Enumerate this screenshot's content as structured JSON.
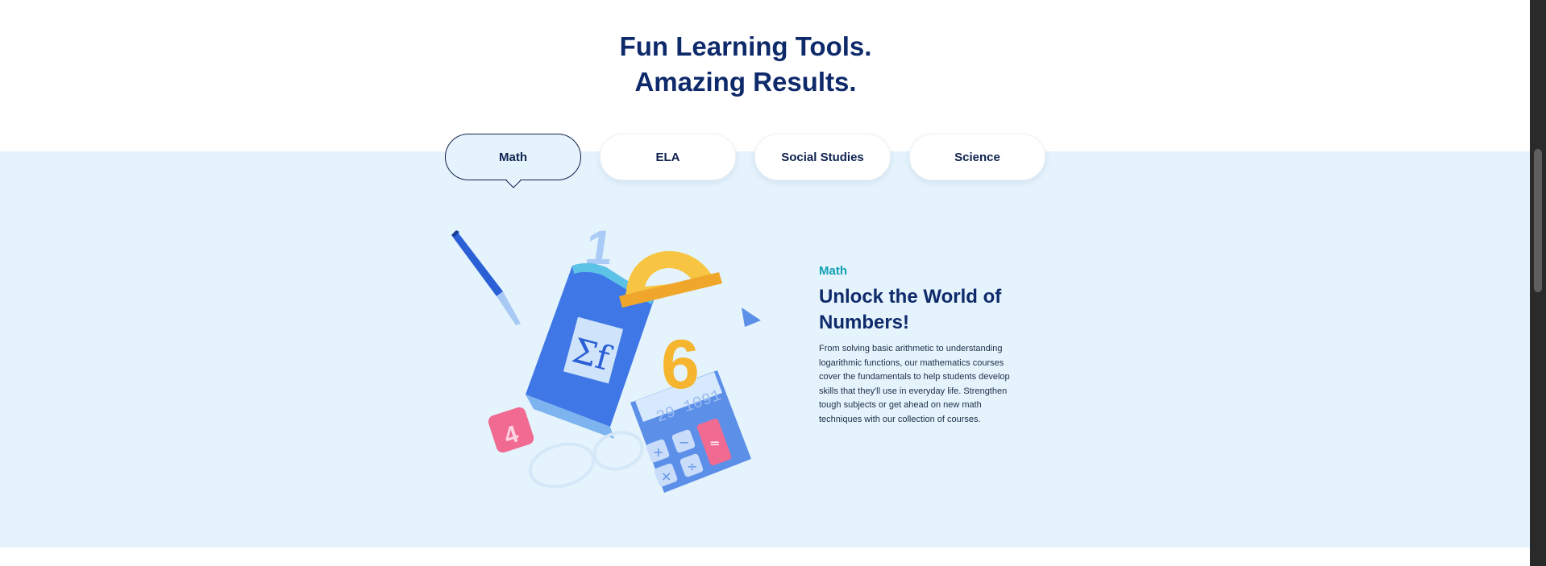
{
  "section": {
    "heading_line1": "Fun Learning Tools.",
    "heading_line2": "Amazing Results."
  },
  "tabs": [
    {
      "label": "Math",
      "active": true
    },
    {
      "label": "ELA",
      "active": false
    },
    {
      "label": "Social Studies",
      "active": false
    },
    {
      "label": "Science",
      "active": false
    }
  ],
  "panel": {
    "eyebrow": "Math",
    "title": "Unlock the World of Numbers!",
    "body": "From solving basic arithmetic to understanding logarithmic functions, our mathematics courses cover the fundamentals to help students develop skills that they'll use in everyday life. Strengthen tough subjects or get ahead on new math techniques with our collection of courses."
  },
  "illustration": {
    "book_symbol": "Σf",
    "digit_one": "1",
    "digit_six": "6",
    "tile_digit": "4",
    "calculator_display": "29 1091",
    "calculator_keys": [
      "+",
      "−",
      "×",
      "÷",
      "="
    ]
  },
  "colors": {
    "heading": "#0f2a6b",
    "band_background": "#e4f3fc",
    "eyebrow": "#12a0b3",
    "active_tab_border": "#14204a"
  },
  "icons": [
    "pen-icon",
    "book-icon",
    "protractor-icon",
    "calculator-icon",
    "glasses-icon",
    "number-tile-icon",
    "triangle-icon"
  ]
}
